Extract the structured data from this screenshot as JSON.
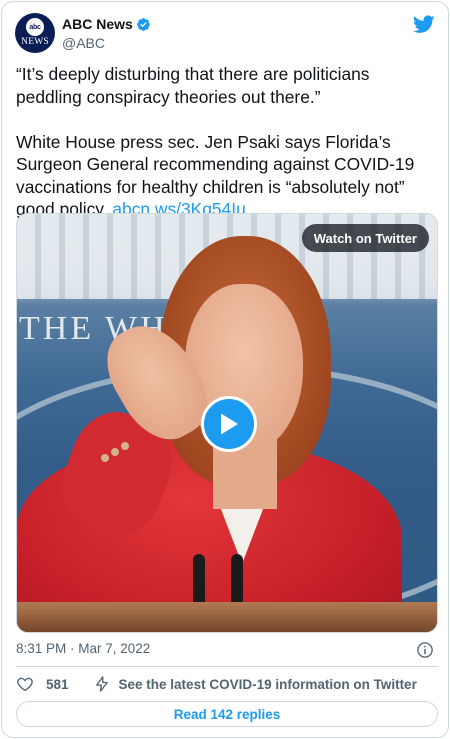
{
  "author": {
    "name": "ABC News",
    "handle": "@ABC",
    "avatar_top": "abc",
    "avatar_bottom": "NEWS",
    "verified": true
  },
  "tweet": {
    "quote": "“It’s deeply disturbing that there are politicians peddling conspiracy theories out there.”",
    "body": "White House press sec. Jen Psaki says Florida’s Surgeon General recommending against COVID-19 vaccinations for healthy children is “absolutely not” good policy. ",
    "link": "abcn.ws/3Kq54Iu"
  },
  "media": {
    "watch_label": "Watch on Twitter",
    "banner_text": "THE WH   OUSE"
  },
  "meta": {
    "timestamp": "8:31 PM · Mar 7, 2022"
  },
  "actions": {
    "like_count": "581",
    "covid_info": "See the latest COVID-19 information on Twitter"
  },
  "replies": {
    "label": "Read 142 replies"
  },
  "colors": {
    "accent": "#1d9bf0",
    "text": "#0f1419",
    "secondary": "#536471",
    "border": "#cfd9de"
  },
  "icons": [
    "verified-badge-icon",
    "twitter-bird-icon",
    "play-icon",
    "info-icon",
    "heart-icon",
    "bolt-icon"
  ]
}
